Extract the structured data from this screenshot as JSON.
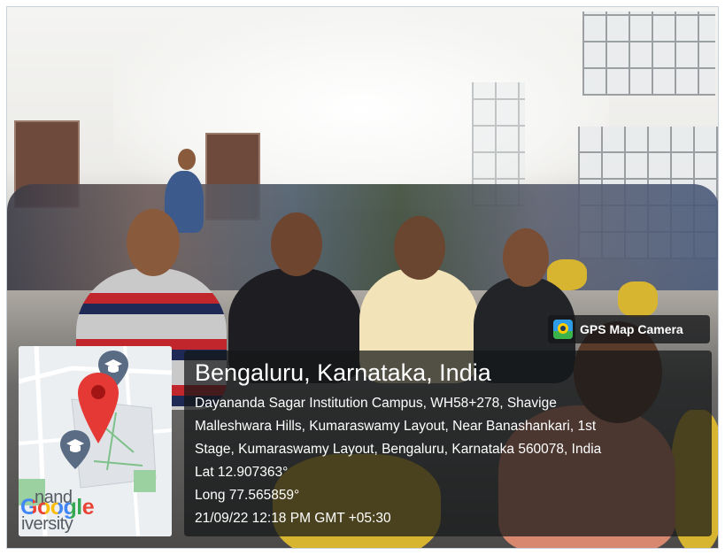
{
  "photo": {
    "subject": "classroom-group-photo"
  },
  "badge": {
    "label": "GPS Map Camera",
    "icon": "gps-map-camera-icon"
  },
  "map": {
    "logo_text": "Google",
    "label_lines": [
      "nand",
      "iversity"
    ],
    "pin_color": "#e53935",
    "markers": [
      "graduation-cap-icon",
      "graduation-cap-icon"
    ]
  },
  "location": {
    "title": "Bengaluru, Karnataka, India",
    "address_lines": [
      "Dayananda Sagar Institution Campus, WH58+278, Shavige",
      "Malleshwara Hills, Kumaraswamy Layout, Near Banashankari, 1st",
      "Stage, Kumaraswamy Layout, Bengaluru, Karnataka 560078, India"
    ],
    "lat": "Lat 12.907363°",
    "long": "Long 77.565859°",
    "datetime": "21/09/22 12:18 PM GMT +05:30"
  },
  "colors": {
    "panel_bg": "#161819",
    "chair_yellow": "#d8b531",
    "google_blue": "#4285f4",
    "google_red": "#ea4335",
    "google_yellow": "#fbbc05",
    "google_green": "#34a853"
  }
}
